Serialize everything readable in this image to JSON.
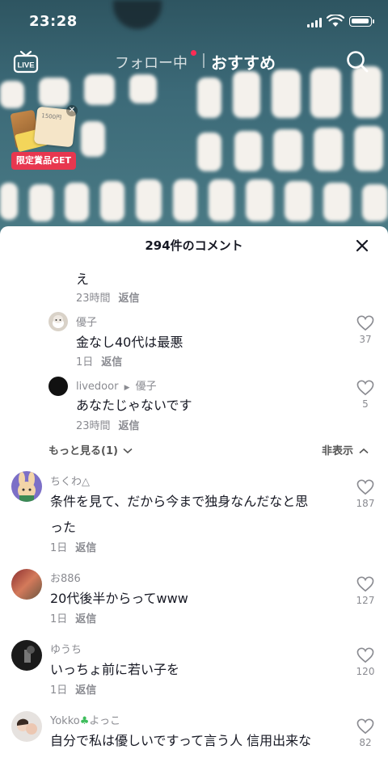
{
  "status_bar": {
    "time": "23:28"
  },
  "top_nav": {
    "live_label": "LIVE",
    "following_tab": "フォロー中",
    "recommend_tab": "おすすめ"
  },
  "promo": {
    "badge": "限定賞品GET",
    "card_text": "1500円"
  },
  "comments_panel": {
    "title": "294件のコメント",
    "reply_label": "返信",
    "partial_reply": {
      "text": "え",
      "time": "23時間"
    },
    "replies": [
      {
        "user": "優子",
        "text": "金なし40代は最悪",
        "time": "1日",
        "likes": "37"
      },
      {
        "user": "livedoor",
        "reply_to": "優子",
        "text": "あなたじゃないです",
        "time": "23時間",
        "likes": "5"
      }
    ],
    "show_more": "もっと見る(1)",
    "hide": "非表示",
    "comments": [
      {
        "user": "ちくわ△",
        "text_line1": "条件を見て、だから今まで独身なんだなと思",
        "text_line2": "った",
        "time": "1日",
        "likes": "187"
      },
      {
        "user": "お886",
        "text": "20代後半からってwww",
        "time": "1日",
        "likes": "127"
      },
      {
        "user": "ゆうち",
        "text": "いっちょ前に若い子を",
        "time": "1日",
        "likes": "120"
      },
      {
        "user_prefix": "Yokko",
        "user_suffix": "よっこ",
        "text": "自分で私は優しいですって言う人 信用出来な",
        "likes": "82"
      }
    ]
  },
  "colors": {
    "accent_red": "#fe2c55",
    "promo_badge": "#e8374f",
    "video_bg": "#3c6a78",
    "clover": "#3ebd5c"
  }
}
